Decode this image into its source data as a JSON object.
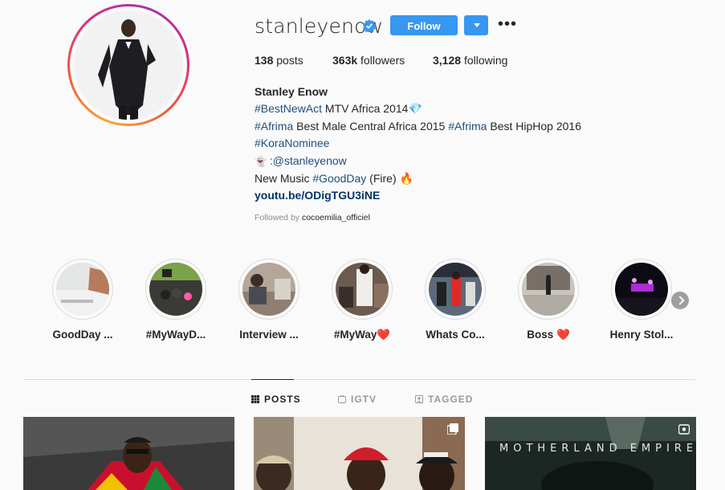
{
  "profile": {
    "username": "stanleyenow",
    "verified_icon": "verified-badge-icon",
    "follow_label": "Follow",
    "posts_count": "138",
    "posts_label": "posts",
    "followers_count": "363k",
    "followers_label": "followers",
    "following_count": "3,128",
    "following_label": "following",
    "accent_color": "#3897f0"
  },
  "bio": {
    "name": "Stanley Enow",
    "line1_tag": "#BestNewAct",
    "line1_text": " MTV Africa 2014",
    "line2_tag1": "#Afrima",
    "line2_text1": " Best Male Central Africa 2015 ",
    "line2_tag2": "#Afrima",
    "line2_text2": " Best HipHop 2016",
    "line3_tag": "#KoraNominee",
    "line4_text": ":@stanleyenow",
    "line5_text1": "New Music ",
    "line5_tag": "#GoodDay",
    "line5_text2": " (Fire) ",
    "link": "youtu.be/ODigTGU3iNE",
    "followed_by_label": "Followed by ",
    "followed_by_user": "cocoemilia_officiel"
  },
  "highlights": [
    {
      "label": "GoodDay ..."
    },
    {
      "label": "#MyWayD..."
    },
    {
      "label": "Interview ..."
    },
    {
      "label": "#MyWay❤️"
    },
    {
      "label": "Whats Co..."
    },
    {
      "label": "Boss ❤️"
    },
    {
      "label": "Henry Stol..."
    }
  ],
  "tabs": [
    {
      "label": "POSTS",
      "icon": "grid-icon",
      "active": true
    },
    {
      "label": "IGTV",
      "icon": "igtv-icon",
      "active": false
    },
    {
      "label": "TAGGED",
      "icon": "tagged-icon",
      "active": false
    }
  ],
  "posts": [
    {
      "caption": ""
    },
    {
      "caption": ""
    },
    {
      "caption": "MOTHERLAND EMPIRE"
    }
  ]
}
